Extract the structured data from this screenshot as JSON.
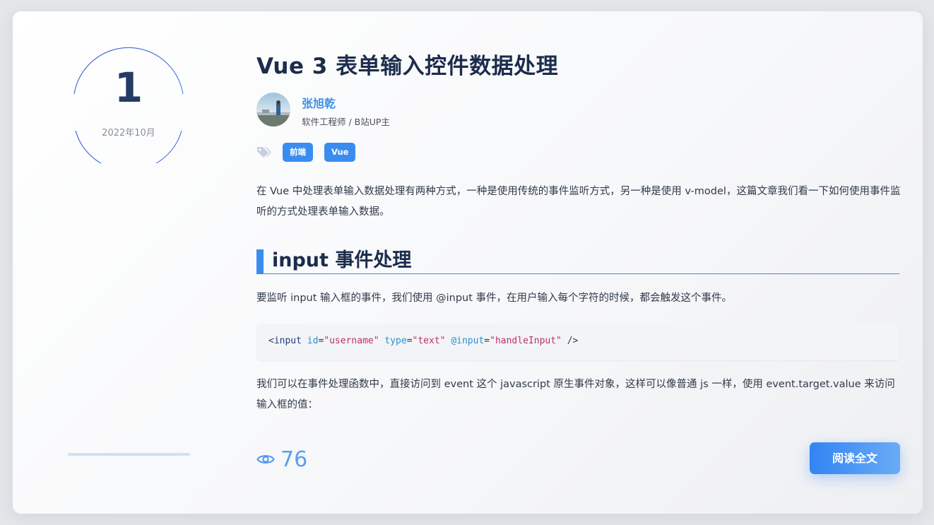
{
  "date": {
    "day": "1",
    "month": "2022年10月"
  },
  "article": {
    "title": "Vue 3 表单输入控件数据处理",
    "author": {
      "name": "张旭乾",
      "description": "软件工程师 / B站UP主"
    },
    "tags": [
      "前端",
      "Vue"
    ],
    "paragraphs": {
      "intro": "在 Vue 中处理表单输入数据处理有两种方式，一种是使用传统的事件监听方式，另一种是使用 v-model，这篇文章我们看一下如何使用事件监听的方式处理表单输入数据。",
      "section_text": "要监听 input 输入框的事件，我们使用 @input 事件，在用户输入每个字符的时候，都会触发这个事件。",
      "after_code": "我们可以在事件处理函数中，直接访问到 event 这个 javascript 原生事件对象，这样可以像普通 js 一样，使用 event.target.value 来访问输入框的值："
    },
    "section_heading": "input 事件处理",
    "code": {
      "open": "<",
      "tag": "input",
      "attr1": "id",
      "eq1": "=",
      "val1": "\"username\"",
      "attr2": "type",
      "eq2": "=",
      "val2": "\"text\"",
      "attr3": "@input",
      "eq3": "=",
      "val3": "\"handleInput\"",
      "close": " />"
    },
    "views": "76",
    "read_more_label": "阅读全文"
  },
  "colors": {
    "accent": "#3b8cf0",
    "title": "#1c2c4c",
    "date_day": "#243b63"
  },
  "icons": {
    "tag": "tags-icon",
    "views": "eye-icon"
  }
}
